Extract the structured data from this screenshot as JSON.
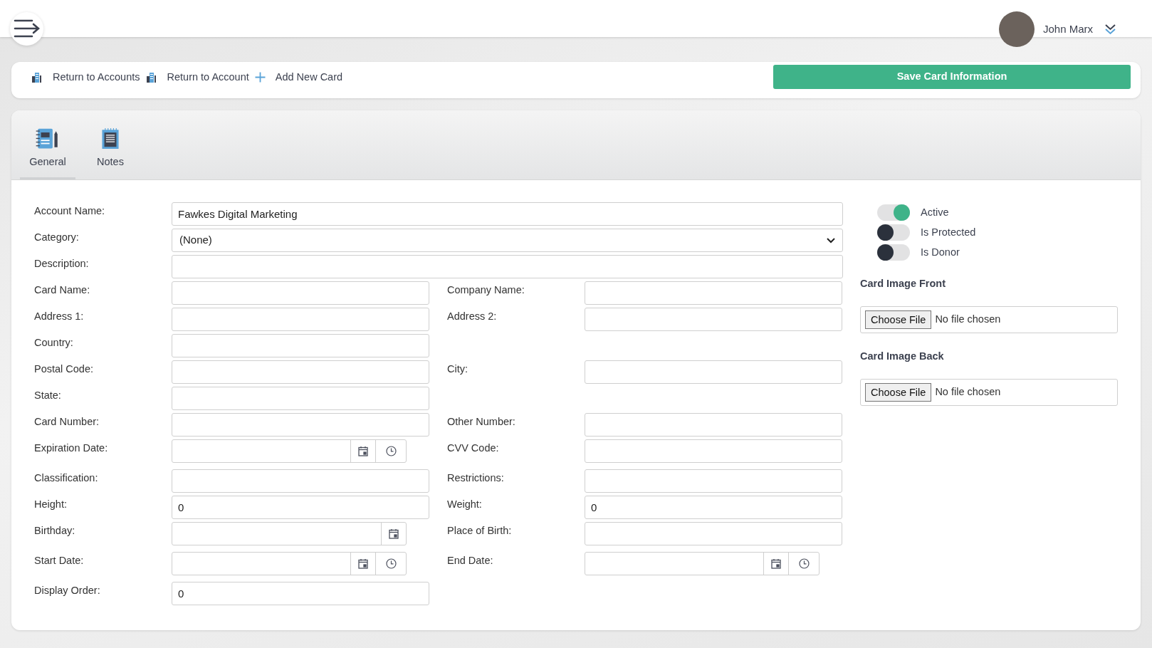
{
  "user": {
    "name": "John Marx"
  },
  "actions": [
    {
      "kind": "building",
      "label": "Return to Accounts"
    },
    {
      "kind": "building",
      "label": "Return to Account"
    },
    {
      "kind": "plus",
      "label": "Add New Card"
    }
  ],
  "save_button": "Save Card Information",
  "tabs": [
    {
      "kind": "general",
      "label": "General",
      "selected": true
    },
    {
      "kind": "notes",
      "label": "Notes",
      "selected": false
    }
  ],
  "wide_fields": [
    {
      "label": "Account Name:",
      "kind": "text",
      "value": "Fawkes Digital Marketing"
    },
    {
      "label": "Category:",
      "kind": "select",
      "value": "(None)"
    },
    {
      "label": "Description:",
      "kind": "text"
    }
  ],
  "rows": [
    {
      "left": {
        "label": "Card Name:",
        "kind": "text"
      },
      "right": {
        "label": "Company Name:",
        "kind": "text"
      }
    },
    {
      "left": {
        "label": "Address 1:",
        "kind": "text"
      },
      "right": {
        "label": "Address 2:",
        "kind": "text"
      }
    },
    {
      "left": {
        "label": "Country:",
        "kind": "text"
      }
    },
    {
      "left": {
        "label": "Postal Code:",
        "kind": "text"
      },
      "right": {
        "label": "City:",
        "kind": "text"
      }
    },
    {
      "left": {
        "label": "State:",
        "kind": "text"
      }
    },
    {
      "left": {
        "label": "Card Number:",
        "kind": "text"
      },
      "right": {
        "label": "Other Number:",
        "kind": "text"
      }
    },
    {
      "left": {
        "label": "Expiration Date:",
        "kind": "datetime"
      },
      "right": {
        "label": "CVV Code:",
        "kind": "text"
      }
    },
    {
      "left": {
        "label": "Classification:",
        "kind": "text"
      },
      "right": {
        "label": "Restrictions:",
        "kind": "text"
      }
    },
    {
      "left": {
        "label": "Height:",
        "kind": "text",
        "value": "0"
      },
      "right": {
        "label": "Weight:",
        "kind": "text",
        "value": "0"
      }
    },
    {
      "left": {
        "label": "Birthday:",
        "kind": "date"
      },
      "right": {
        "label": "Place of Birth:",
        "kind": "text"
      }
    },
    {
      "left": {
        "label": "Start Date:",
        "kind": "datetime"
      },
      "right": {
        "label": "End Date:",
        "kind": "datetime"
      }
    },
    {
      "left": {
        "label": "Display Order:",
        "kind": "text",
        "value": "0"
      }
    }
  ],
  "toggles": [
    {
      "label": "Active",
      "on": true
    },
    {
      "label": "Is Protected",
      "on": false
    },
    {
      "label": "Is Donor",
      "on": false
    }
  ],
  "uploads": [
    {
      "title": "Card Image Front",
      "button": "Choose File",
      "status": "No file chosen"
    },
    {
      "title": "Card Image Back",
      "button": "Choose File",
      "status": "No file chosen"
    }
  ]
}
